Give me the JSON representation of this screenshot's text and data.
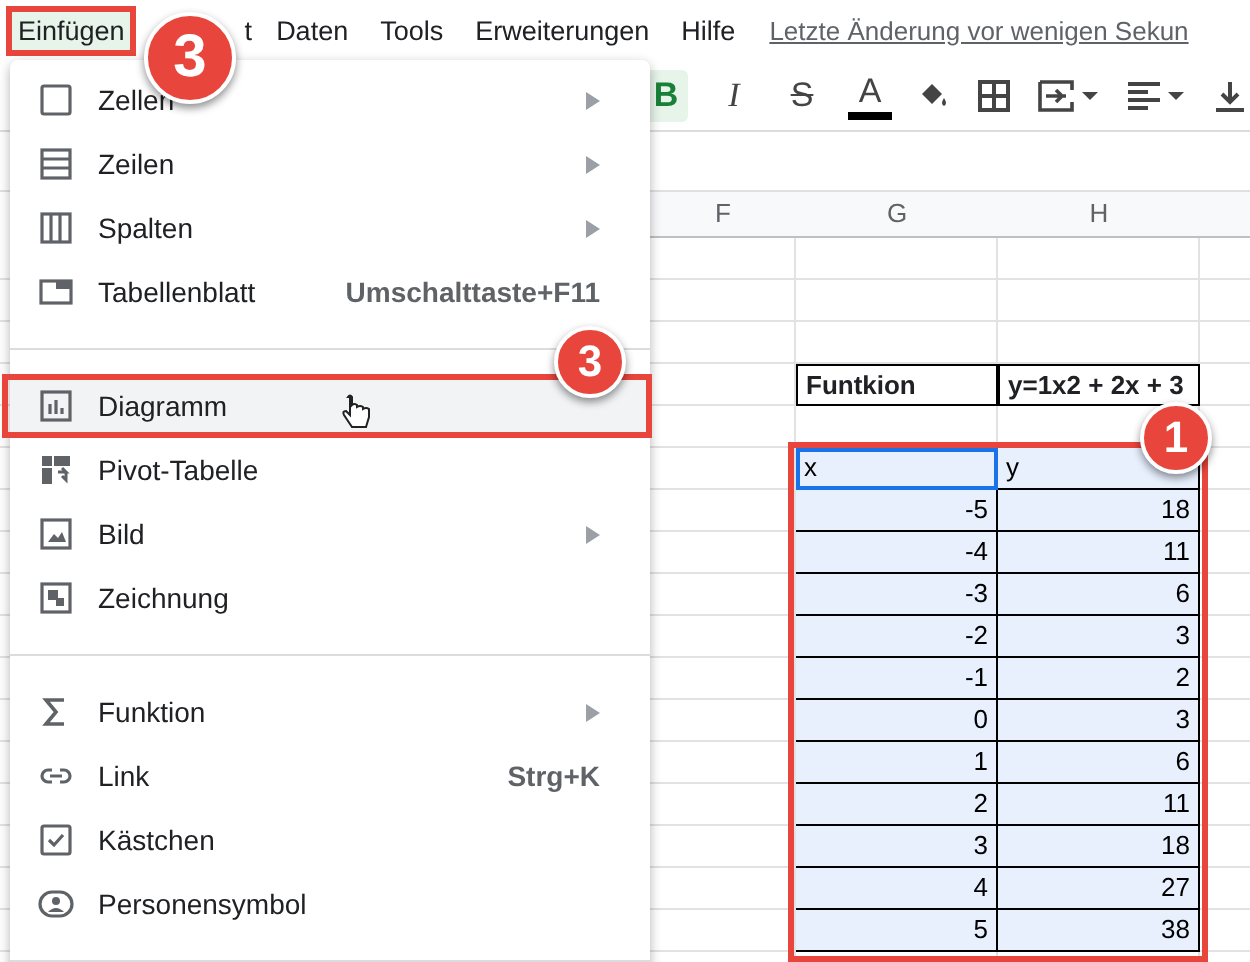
{
  "menubar": {
    "items": [
      {
        "label": "Einfügen",
        "selected": true
      },
      {
        "label": "t",
        "selected": false
      },
      {
        "label": "Daten",
        "selected": false
      },
      {
        "label": "Tools",
        "selected": false
      },
      {
        "label": "Erweiterungen",
        "selected": false
      },
      {
        "label": "Hilfe",
        "selected": false
      }
    ],
    "last_edit": "Letzte Änderung vor wenigen Sekun"
  },
  "toolbar": {
    "buttons": [
      {
        "kind": "bold",
        "label": "B",
        "on": true
      },
      {
        "kind": "italic",
        "label": "I",
        "on": false
      },
      {
        "kind": "strike",
        "label": "S",
        "on": false
      },
      {
        "kind": "text-color",
        "label": "A",
        "on": false
      },
      {
        "kind": "fill",
        "on": false
      },
      {
        "kind": "borders",
        "on": false
      },
      {
        "kind": "merge",
        "on": false
      },
      {
        "kind": "align",
        "on": false
      },
      {
        "kind": "valign",
        "on": false
      }
    ]
  },
  "menu": {
    "items": [
      {
        "kind": "item",
        "label": "Zellen",
        "submenu": true,
        "selected": false
      },
      {
        "kind": "item",
        "label": "Zeilen",
        "submenu": true,
        "selected": false
      },
      {
        "kind": "item",
        "label": "Spalten",
        "submenu": true,
        "selected": false
      },
      {
        "kind": "item",
        "label": "Tabellenblatt",
        "shortcut": "Umschalttaste+F11",
        "submenu": false,
        "selected": false
      },
      {
        "kind": "divider"
      },
      {
        "kind": "item",
        "label": "Diagramm",
        "submenu": false,
        "selected": true
      },
      {
        "kind": "item",
        "label": "Pivot-Tabelle",
        "submenu": false,
        "selected": false
      },
      {
        "kind": "item",
        "label": "Bild",
        "submenu": true,
        "selected": false
      },
      {
        "kind": "item",
        "label": "Zeichnung",
        "submenu": false,
        "selected": false
      },
      {
        "kind": "divider"
      },
      {
        "kind": "item",
        "label": "Funktion",
        "submenu": true,
        "selected": false
      },
      {
        "kind": "item",
        "label": "Link",
        "shortcut": "Strg+K",
        "submenu": false,
        "selected": false
      },
      {
        "kind": "item",
        "label": "Kästchen",
        "submenu": false,
        "selected": false
      },
      {
        "kind": "item",
        "label": "Personensymbol",
        "submenu": false,
        "selected": false
      },
      {
        "kind": "divider"
      }
    ]
  },
  "sheet": {
    "columns": [
      "F",
      "G",
      "H"
    ],
    "function_row": {
      "label": "Funtkion",
      "formula": "y=1x2 + 2x + 3"
    },
    "data_table": {
      "columns": [
        "x",
        "y"
      ],
      "rows": [
        [
          "-5",
          "18"
        ],
        [
          "-4",
          "11"
        ],
        [
          "-3",
          "6"
        ],
        [
          "-2",
          "3"
        ],
        [
          "-1",
          "2"
        ],
        [
          "0",
          "3"
        ],
        [
          "1",
          "6"
        ],
        [
          "2",
          "11"
        ],
        [
          "3",
          "18"
        ],
        [
          "4",
          "27"
        ],
        [
          "5",
          "38"
        ]
      ]
    }
  },
  "callouts": [
    {
      "label": "3"
    },
    {
      "label": "3"
    },
    {
      "label": "1"
    }
  ]
}
